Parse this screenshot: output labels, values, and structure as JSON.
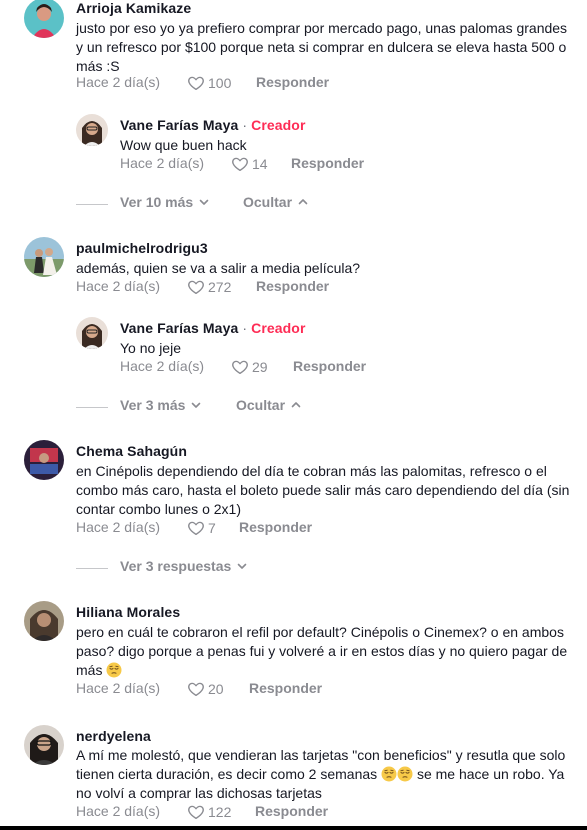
{
  "comments": [
    {
      "username": "Arrioja Kamikaze",
      "text": "justo por eso yo ya prefiero comprar por mercado pago, unas palomas grandes y un refresco por $100 porque neta si comprar en dulcera se eleva hasta 500 o más :S",
      "date": "Hace 2 día(s)",
      "likes": "100",
      "reply_label": "Responder",
      "reply": {
        "username": "Vane Farías Maya",
        "separator": "·",
        "badge": "Creador",
        "text": "Wow que buen hack",
        "date": "Hace 2 día(s)",
        "likes": "14",
        "reply_label": "Responder"
      },
      "view_more": "Ver 10 más",
      "hide": "Ocultar"
    },
    {
      "username": "paulmichelrodrigu3",
      "text": "además, quien se va a salir a media película?",
      "date": "Hace 2 día(s)",
      "likes": "272",
      "reply_label": "Responder",
      "reply": {
        "username": "Vane Farías Maya",
        "separator": "·",
        "badge": "Creador",
        "text": "Yo no jeje",
        "date": "Hace 2 día(s)",
        "likes": "29",
        "reply_label": "Responder"
      },
      "view_more": "Ver 3 más",
      "hide": "Ocultar"
    },
    {
      "username": "Chema Sahagún",
      "text": "en Cinépolis dependiendo del día te cobran más las palomitas, refresco o el combo más caro, hasta el boleto puede salir más caro dependiendo del día (sin contar combo lunes o 2x1)",
      "date": "Hace 2 día(s)",
      "likes": "7",
      "reply_label": "Responder",
      "view_more": "Ver 3 respuestas"
    },
    {
      "username": "Hiliana Morales",
      "text": "pero en cuál te cobraron el refil por default? Cinépolis o Cinemex? o en ambos paso? digo porque a penas fui y volveré a ir en estos días y no quiero pagar de más",
      "date": "Hace 2 día(s)",
      "likes": "20",
      "reply_label": "Responder"
    },
    {
      "username": "nerdyelena",
      "text": "A mí me molestó, que vendieran las tarjetas \"con beneficios\" y resutla que solo tienen cierta duración, es decir como 2 semanas",
      "text_after": "se me hace un robo. Ya no volví a comprar las dichosas tarjetas",
      "date": "Hace 2 día(s)",
      "likes": "122",
      "reply_label": "Responder"
    }
  ],
  "colors": {
    "creator": "#fe2c55",
    "muted": "#8a8b91",
    "text": "#161823"
  },
  "icons": [
    "heart-outline-icon",
    "chevron-down-icon",
    "chevron-up-icon",
    "pensive-face-emoji"
  ]
}
